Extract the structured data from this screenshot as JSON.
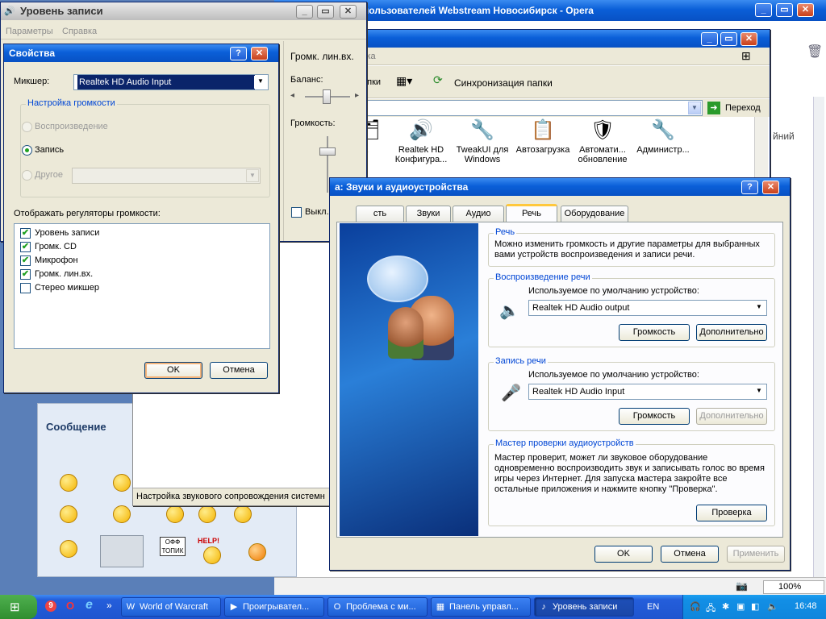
{
  "opera": {
    "title": "пользователей Webstream Новосибирск - Opera",
    "minimize": "_",
    "restore": "▭",
    "close": "✕",
    "zoom": "100%",
    "page": {
      "heading": "Сообщение",
      "right_text": "йний"
    }
  },
  "explorer": {
    "address_frag": "ска",
    "toolbar_frag": "апки",
    "sync_label": "Синхронизация папки",
    "go_label": "Переход",
    "icons": [
      {
        "label": "а",
        "glyph": "🗂"
      },
      {
        "label": "Realtek HD Конфигура...",
        "glyph": "🔊"
      },
      {
        "label": "TweakUI для Windows",
        "glyph": "🔧"
      },
      {
        "label": "Автозагрузка",
        "glyph": "📋"
      },
      {
        "label": "Автомати... обновление",
        "glyph": "🛡"
      },
      {
        "label": "Администр...",
        "glyph": "🔧"
      }
    ]
  },
  "recording": {
    "title": "Уровень записи",
    "menu": [
      "Параметры",
      "Справка"
    ],
    "column_title": "Громк. лин.вх.",
    "balance_label": "Баланс:",
    "volume_label": "Громкость:",
    "mute_label": "Выкл."
  },
  "properties": {
    "title": "Свойства",
    "help_btn": "?",
    "close_btn": "✕",
    "mixer_label": "Микшер:",
    "mixer_value": "Realtek HD Audio Input",
    "group_label": "Настройка громкости",
    "radio_playback": "Воспроизведение",
    "radio_record": "Запись",
    "radio_other": "Другое",
    "show_label": "Отображать регуляторы громкости:",
    "items": [
      {
        "label": "Уровень записи",
        "checked": true
      },
      {
        "label": "Громк. CD",
        "checked": true
      },
      {
        "label": "Микрофон",
        "checked": true
      },
      {
        "label": "Громк. лин.вх.",
        "checked": true
      },
      {
        "label": "Стерео микшер",
        "checked": false
      }
    ],
    "ok": "OK",
    "cancel": "Отмена"
  },
  "midwin": {
    "status": "Настройка звукового сопровождения системн"
  },
  "sound": {
    "title": "а: Звуки и аудиоустройства",
    "help_btn": "?",
    "close_btn": "✕",
    "tabs": [
      "сть",
      "Звуки",
      "Аудио",
      "Речь",
      "Оборудование"
    ],
    "speech_group": "Речь",
    "speech_desc": "Можно изменить громкость и другие параметры для выбранных вами устройств воспроизведения и записи речи.",
    "playback_group": "Воспроизведение речи",
    "default_device_label": "Используемое по умолчанию устройство:",
    "playback_device": "Realtek HD Audio output",
    "volume_btn": "Громкость",
    "advanced_btn": "Дополнительно",
    "record_group": "Запись речи",
    "record_device": "Realtek HD Audio Input",
    "wizard_group": "Мастер проверки аудиоустройств",
    "wizard_desc": "Мастер проверит, может ли звуковое оборудование одновременно воспроизводить звук и записывать голос во время игры через Интернет. Для запуска мастера закройте все остальные приложения и нажмите кнопку \"Проверка\".",
    "check_btn": "Проверка",
    "ok": "OK",
    "cancel": "Отмена",
    "apply": "Применить"
  },
  "smileys": {
    "offtopic_sign": "ОФФ ТОПИК",
    "help_sign": "HELP!"
  },
  "taskbar": {
    "start_label": "",
    "buttons": [
      {
        "label": "World of Warcraft",
        "icon": "W",
        "active": false
      },
      {
        "label": "Проигрывател...",
        "icon": "▶",
        "active": false
      },
      {
        "label": "Проблема с ми...",
        "icon": "O",
        "active": false
      },
      {
        "label": "Панель управл...",
        "icon": "▦",
        "active": false
      },
      {
        "label": "Уровень записи",
        "icon": "♪",
        "active": true
      }
    ],
    "lang": "EN",
    "clock": "16:48",
    "quick_launch": [
      "9",
      "O",
      "e",
      "»"
    ]
  }
}
